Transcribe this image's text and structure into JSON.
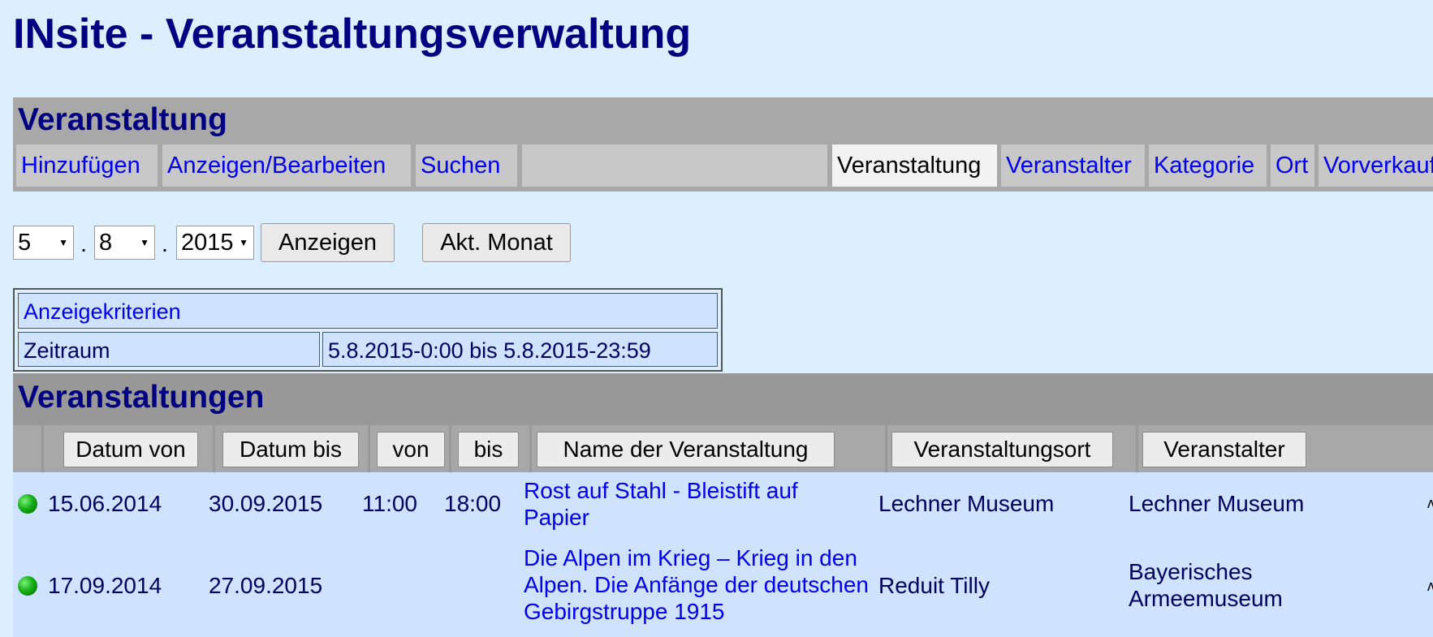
{
  "app": {
    "title": "INsite - Veranstaltungsverwaltung"
  },
  "nav": {
    "section_title": "Veranstaltung",
    "actions": [
      "Hinzufügen",
      "Anzeigen/Bearbeiten",
      "Suchen"
    ],
    "tabs": [
      "Veranstaltung",
      "Veranstalter",
      "Kategorie",
      "Ort",
      "Vorverkauf"
    ],
    "active_tab": "Veranstaltung"
  },
  "date_selector": {
    "day": "5",
    "month": "8",
    "year": "2015",
    "separator": ".",
    "show_button": "Anzeigen",
    "current_month_button": "Akt. Monat"
  },
  "criteria": {
    "title": "Anzeigekriterien",
    "label": "Zeitraum",
    "value": "5.8.2015-0:00 bis 5.8.2015-23:59"
  },
  "events": {
    "section_title": "Veranstaltungen",
    "columns": [
      "Datum von",
      "Datum bis",
      "von",
      "bis",
      "Name der Veranstaltung",
      "Veranstaltungsort",
      "Veranstalter"
    ],
    "rows": [
      {
        "status": "green",
        "datum_von": "15.06.2014",
        "datum_bis": "30.09.2015",
        "von": "11:00",
        "bis": "18:00",
        "name": "Rost auf Stahl - Bleistift auf Papier",
        "ort": "Lechner Museum",
        "veranstalter": "Lechner Museum"
      },
      {
        "status": "green",
        "datum_von": "17.09.2014",
        "datum_bis": "27.09.2015",
        "von": "",
        "bis": "",
        "name": "Die Alpen im Krieg – Krieg in den Alpen. Die Anfänge der deutschen Gebirgstruppe 1915",
        "ort": "Reduit Tilly",
        "veranstalter": "Bayerisches Armeemuseum"
      }
    ]
  },
  "colors": {
    "background": "#dcefff",
    "panel": "#a8a8a8",
    "title": "#000080",
    "link": "#0000ee",
    "row": "#cfe3ff",
    "status_green": "#17b017"
  }
}
